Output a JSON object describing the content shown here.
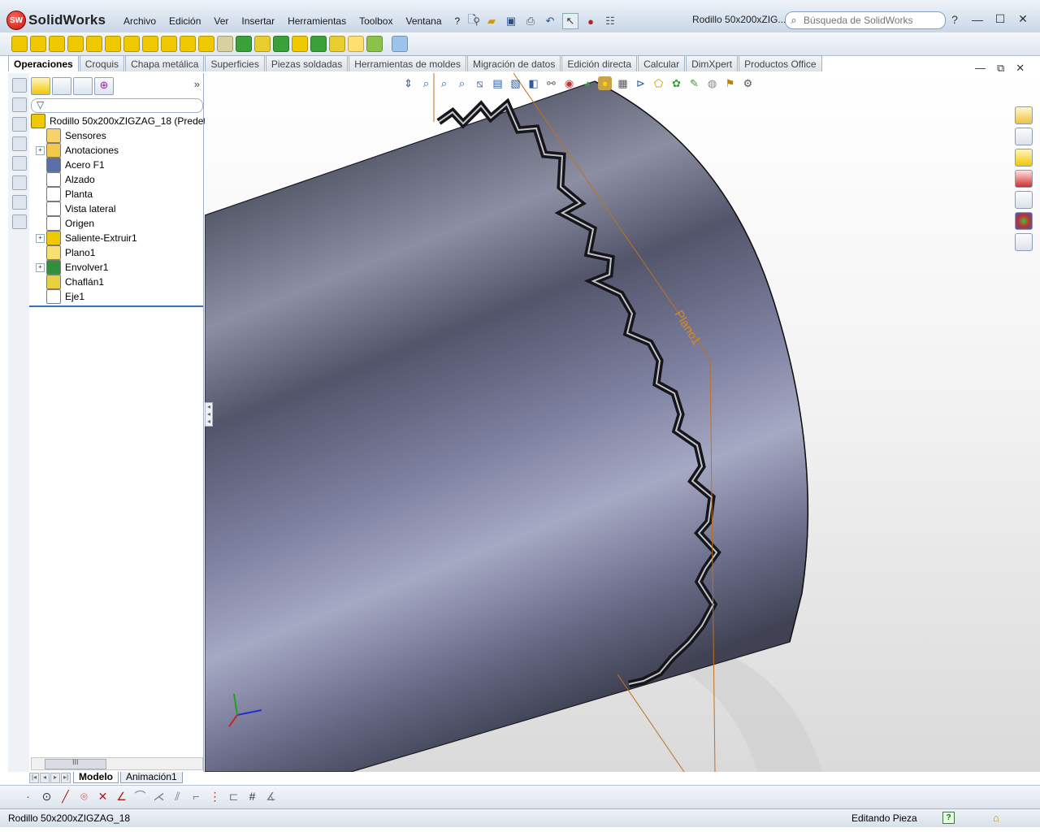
{
  "app": {
    "logo_badge": "SW",
    "name": "SolidWorks"
  },
  "menu": [
    "Archivo",
    "Edición",
    "Ver",
    "Insertar",
    "Herramientas",
    "Toolbox",
    "Ventana",
    "?"
  ],
  "document_title": "Rodillo 50x200xZIG...",
  "search": {
    "placeholder": "Búsqueda de SolidWorks"
  },
  "command_tabs": [
    {
      "label": "Operaciones",
      "active": true
    },
    {
      "label": "Croquis"
    },
    {
      "label": "Chapa metálica"
    },
    {
      "label": "Superficies"
    },
    {
      "label": "Piezas soldadas"
    },
    {
      "label": "Herramientas de moldes"
    },
    {
      "label": "Migración de datos"
    },
    {
      "label": "Edición directa"
    },
    {
      "label": "Calcular"
    },
    {
      "label": "DimXpert"
    },
    {
      "label": "Productos Office"
    }
  ],
  "feature_tree": {
    "root": "Rodillo 50x200xZIGZAG_18  (Predeterm",
    "items": [
      {
        "label": "Sensores",
        "icon": "sensor-folder-icon",
        "expandable": false
      },
      {
        "label": "Anotaciones",
        "icon": "annotations-icon",
        "expandable": true
      },
      {
        "label": "Acero F1",
        "icon": "material-icon",
        "expandable": false
      },
      {
        "label": "Alzado",
        "icon": "plane-icon",
        "expandable": false
      },
      {
        "label": "Planta",
        "icon": "plane-icon",
        "expandable": false
      },
      {
        "label": "Vista lateral",
        "icon": "plane-icon",
        "expandable": false
      },
      {
        "label": "Origen",
        "icon": "origin-icon",
        "expandable": false
      },
      {
        "label": "Saliente-Extruir1",
        "icon": "extrude-icon",
        "expandable": true
      },
      {
        "label": "Plano1",
        "icon": "plane-yellow-icon",
        "expandable": false
      },
      {
        "label": "Envolver1",
        "icon": "wrap-icon",
        "expandable": true
      },
      {
        "label": "Chaflán1",
        "icon": "chamfer-icon",
        "expandable": false
      },
      {
        "label": "Eje1",
        "icon": "axis-icon",
        "expandable": false
      }
    ],
    "scroll_grip": "III"
  },
  "bottom_tabs": [
    {
      "label": "Modelo",
      "active": true
    },
    {
      "label": "Animación1"
    }
  ],
  "viewport": {
    "plane_label": "Plano1"
  },
  "status": {
    "left": "Rodillo 50x200xZIGZAG_18",
    "right": "Editando Pieza",
    "help": "?"
  }
}
